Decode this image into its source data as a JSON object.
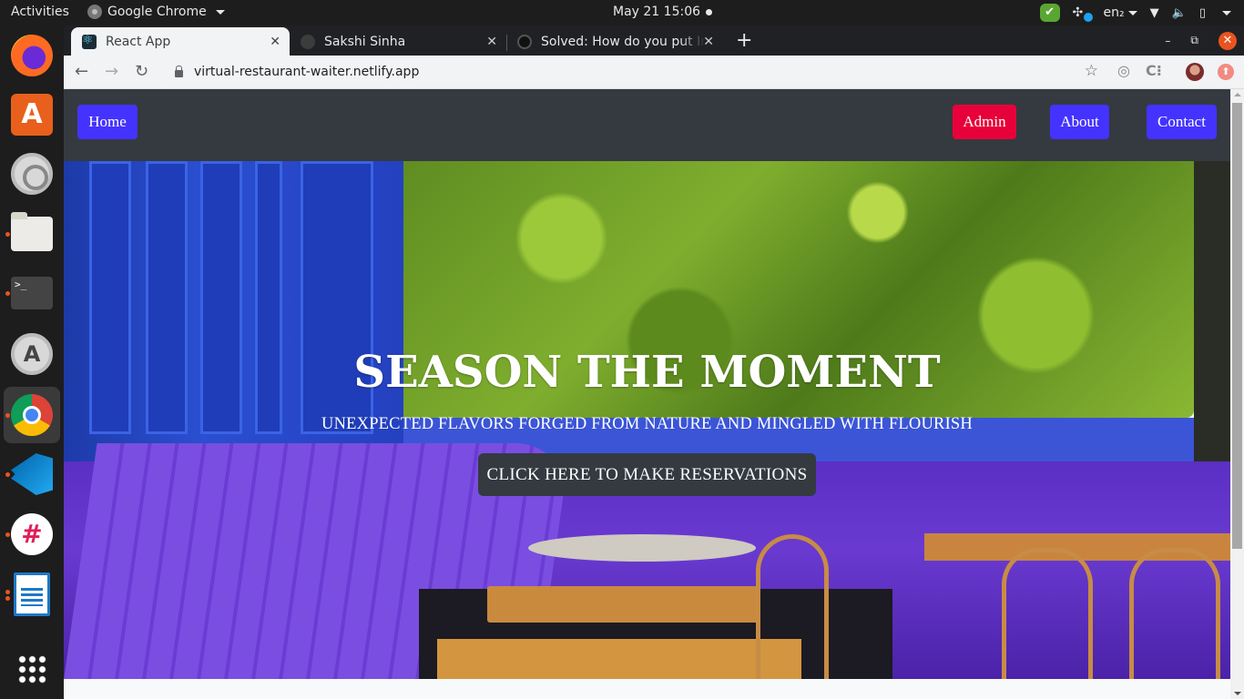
{
  "system": {
    "activities_label": "Activities",
    "app_menu_label": "Google Chrome",
    "clock": "May 21  15:06",
    "language": "en₂",
    "tray_icons": [
      "check-badge-icon",
      "slack-tray-icon",
      "wifi-icon",
      "volume-icon",
      "battery-icon",
      "system-menu-caret-icon"
    ]
  },
  "dock": {
    "items": [
      {
        "name": "firefox",
        "running": false,
        "active": false
      },
      {
        "name": "ubuntu-software",
        "running": false,
        "active": false
      },
      {
        "name": "settings",
        "running": false,
        "active": false
      },
      {
        "name": "files",
        "running": true,
        "active": false
      },
      {
        "name": "terminal",
        "running": true,
        "active": false
      },
      {
        "name": "software-updater",
        "running": false,
        "active": false
      },
      {
        "name": "google-chrome",
        "running": true,
        "active": true
      },
      {
        "name": "vscode",
        "running": true,
        "active": false
      },
      {
        "name": "slack",
        "running": true,
        "active": false
      },
      {
        "name": "libreoffice-writer",
        "running": true,
        "active": false
      },
      {
        "name": "show-applications",
        "running": false,
        "active": false
      }
    ]
  },
  "browser": {
    "tabs": [
      {
        "title": "React App",
        "active": true,
        "icon": "react-icon"
      },
      {
        "title": "Sakshi Sinha",
        "active": false,
        "icon": "globe-icon"
      },
      {
        "title": "Solved: How do you put In",
        "active": false,
        "icon": "github-icon"
      }
    ],
    "new_tab_symbol": "+",
    "url": "virtual-restaurant-waiter.netlify.app",
    "window_controls": {
      "minimize": "–",
      "restore": "⧉",
      "close": "✕"
    }
  },
  "page": {
    "nav": {
      "home": "Home",
      "admin": "Admin",
      "about": "About",
      "contact": "Contact"
    },
    "hero": {
      "title": "SEASON THE MOMENT",
      "subtitle": "UNEXPECTED FLAVORS FORGED FROM NATURE AND MINGLED WITH FLOURISH",
      "cta": "CLICK HERE TO MAKE RESERVATIONS"
    },
    "colors": {
      "navbar_bg": "#343a40",
      "primary_button": "#4433ff",
      "admin_button": "#e8003a",
      "cta_bg": "#343a40"
    }
  }
}
